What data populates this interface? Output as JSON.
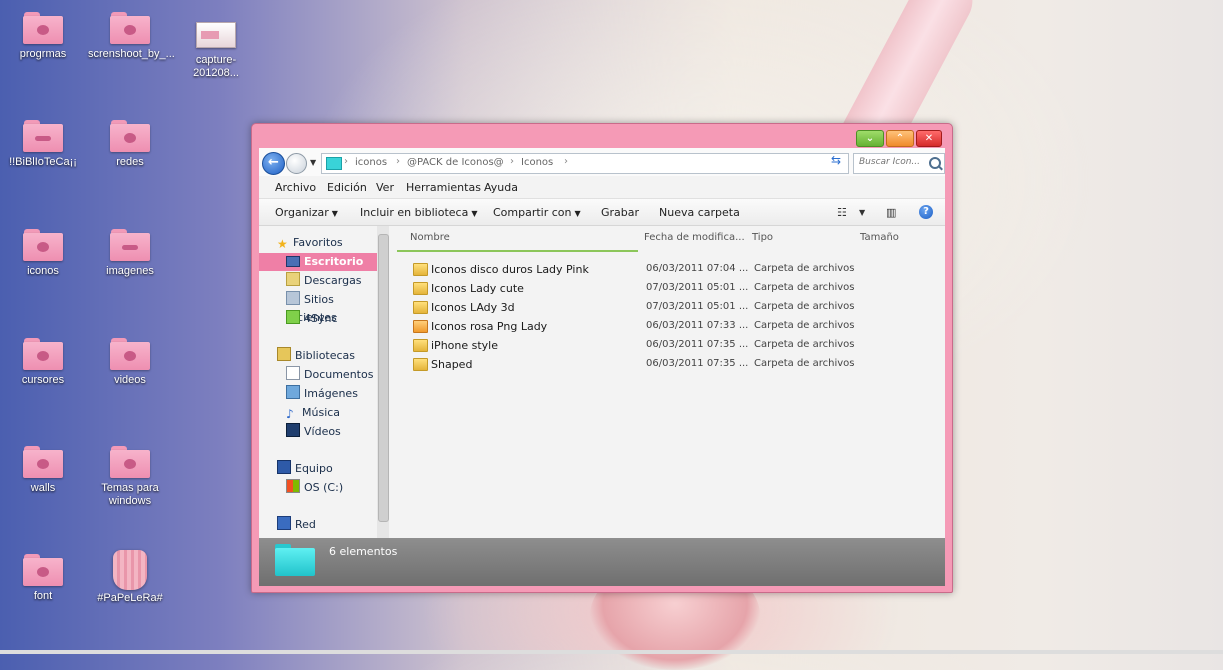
{
  "desktop": {
    "icons": [
      {
        "label": "progrmas"
      },
      {
        "label": "screnshoot_by_..."
      },
      {
        "label": "capture-201208..."
      },
      {
        "label": "!!BiBlIoTeCa¡¡"
      },
      {
        "label": "redes"
      },
      {
        "label": "iconos"
      },
      {
        "label": "imagenes"
      },
      {
        "label": "cursores"
      },
      {
        "label": "videos"
      },
      {
        "label": "walls"
      },
      {
        "label": "Temas para windows"
      },
      {
        "label": "font"
      },
      {
        "label": "#PaPeLeRa#"
      }
    ]
  },
  "window": {
    "controls": {
      "min": "⌄",
      "max": "⌃",
      "close": "✕"
    },
    "breadcrumb": [
      "iconos",
      "@PACK de Iconos@",
      "Iconos"
    ],
    "search_placeholder": "Buscar Icon...",
    "menu": [
      "Archivo",
      "Edición",
      "Ver",
      "Herramientas",
      "Ayuda"
    ],
    "toolbar": {
      "organize": "Organizar",
      "include": "Incluir en biblioteca",
      "share": "Compartir con",
      "burn": "Grabar",
      "new_folder": "Nueva carpeta"
    },
    "nav": {
      "favorites": "Favoritos",
      "desktop": "Escritorio",
      "downloads": "Descargas",
      "recent": "Sitios recientes",
      "sync": "4Sync",
      "libraries": "Bibliotecas",
      "documents": "Documentos",
      "images": "Imágenes",
      "music": "Música",
      "videos": "Vídeos",
      "computer": "Equipo",
      "drive": "OS (C:)",
      "network": "Red"
    },
    "columns": {
      "name": "Nombre",
      "date": "Fecha de modifica...",
      "type": "Tipo",
      "size": "Tamaño"
    },
    "files": [
      {
        "name": "Iconos disco duros Lady Pink",
        "date": "06/03/2011 07:04 ...",
        "type": "Carpeta de archivos"
      },
      {
        "name": "Iconos Lady  cute",
        "date": "07/03/2011 05:01 ...",
        "type": "Carpeta de archivos"
      },
      {
        "name": "Iconos LAdy 3d",
        "date": "07/03/2011 05:01 ...",
        "type": "Carpeta de archivos"
      },
      {
        "name": "Iconos rosa Png Lady",
        "date": "06/03/2011 07:33 ...",
        "type": "Carpeta de archivos"
      },
      {
        "name": "iPhone style",
        "date": "06/03/2011 07:35 ...",
        "type": "Carpeta de archivos"
      },
      {
        "name": "Shaped",
        "date": "06/03/2011 07:35 ...",
        "type": "Carpeta de archivos"
      }
    ],
    "details_count": "6 elementos"
  }
}
